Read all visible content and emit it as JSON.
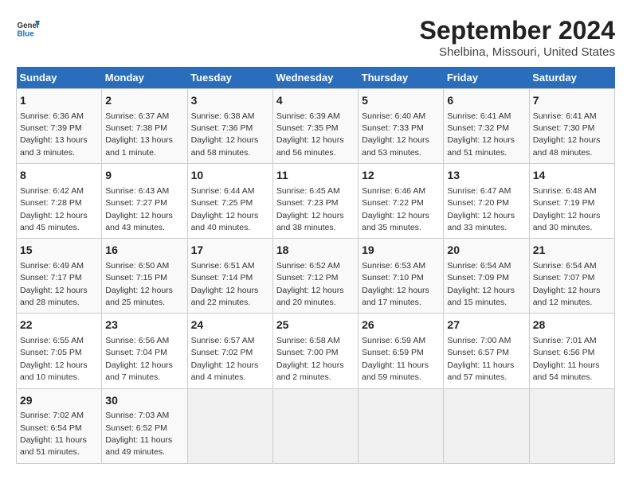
{
  "logo": {
    "line1": "General",
    "line2": "Blue"
  },
  "title": "September 2024",
  "subtitle": "Shelbina, Missouri, United States",
  "days_of_week": [
    "Sunday",
    "Monday",
    "Tuesday",
    "Wednesday",
    "Thursday",
    "Friday",
    "Saturday"
  ],
  "weeks": [
    [
      {
        "day": 1,
        "info": "Sunrise: 6:36 AM\nSunset: 7:39 PM\nDaylight: 13 hours\nand 3 minutes."
      },
      {
        "day": 2,
        "info": "Sunrise: 6:37 AM\nSunset: 7:38 PM\nDaylight: 13 hours\nand 1 minute."
      },
      {
        "day": 3,
        "info": "Sunrise: 6:38 AM\nSunset: 7:36 PM\nDaylight: 12 hours\nand 58 minutes."
      },
      {
        "day": 4,
        "info": "Sunrise: 6:39 AM\nSunset: 7:35 PM\nDaylight: 12 hours\nand 56 minutes."
      },
      {
        "day": 5,
        "info": "Sunrise: 6:40 AM\nSunset: 7:33 PM\nDaylight: 12 hours\nand 53 minutes."
      },
      {
        "day": 6,
        "info": "Sunrise: 6:41 AM\nSunset: 7:32 PM\nDaylight: 12 hours\nand 51 minutes."
      },
      {
        "day": 7,
        "info": "Sunrise: 6:41 AM\nSunset: 7:30 PM\nDaylight: 12 hours\nand 48 minutes."
      }
    ],
    [
      {
        "day": 8,
        "info": "Sunrise: 6:42 AM\nSunset: 7:28 PM\nDaylight: 12 hours\nand 45 minutes."
      },
      {
        "day": 9,
        "info": "Sunrise: 6:43 AM\nSunset: 7:27 PM\nDaylight: 12 hours\nand 43 minutes."
      },
      {
        "day": 10,
        "info": "Sunrise: 6:44 AM\nSunset: 7:25 PM\nDaylight: 12 hours\nand 40 minutes."
      },
      {
        "day": 11,
        "info": "Sunrise: 6:45 AM\nSunset: 7:23 PM\nDaylight: 12 hours\nand 38 minutes."
      },
      {
        "day": 12,
        "info": "Sunrise: 6:46 AM\nSunset: 7:22 PM\nDaylight: 12 hours\nand 35 minutes."
      },
      {
        "day": 13,
        "info": "Sunrise: 6:47 AM\nSunset: 7:20 PM\nDaylight: 12 hours\nand 33 minutes."
      },
      {
        "day": 14,
        "info": "Sunrise: 6:48 AM\nSunset: 7:19 PM\nDaylight: 12 hours\nand 30 minutes."
      }
    ],
    [
      {
        "day": 15,
        "info": "Sunrise: 6:49 AM\nSunset: 7:17 PM\nDaylight: 12 hours\nand 28 minutes."
      },
      {
        "day": 16,
        "info": "Sunrise: 6:50 AM\nSunset: 7:15 PM\nDaylight: 12 hours\nand 25 minutes."
      },
      {
        "day": 17,
        "info": "Sunrise: 6:51 AM\nSunset: 7:14 PM\nDaylight: 12 hours\nand 22 minutes."
      },
      {
        "day": 18,
        "info": "Sunrise: 6:52 AM\nSunset: 7:12 PM\nDaylight: 12 hours\nand 20 minutes."
      },
      {
        "day": 19,
        "info": "Sunrise: 6:53 AM\nSunset: 7:10 PM\nDaylight: 12 hours\nand 17 minutes."
      },
      {
        "day": 20,
        "info": "Sunrise: 6:54 AM\nSunset: 7:09 PM\nDaylight: 12 hours\nand 15 minutes."
      },
      {
        "day": 21,
        "info": "Sunrise: 6:54 AM\nSunset: 7:07 PM\nDaylight: 12 hours\nand 12 minutes."
      }
    ],
    [
      {
        "day": 22,
        "info": "Sunrise: 6:55 AM\nSunset: 7:05 PM\nDaylight: 12 hours\nand 10 minutes."
      },
      {
        "day": 23,
        "info": "Sunrise: 6:56 AM\nSunset: 7:04 PM\nDaylight: 12 hours\nand 7 minutes."
      },
      {
        "day": 24,
        "info": "Sunrise: 6:57 AM\nSunset: 7:02 PM\nDaylight: 12 hours\nand 4 minutes."
      },
      {
        "day": 25,
        "info": "Sunrise: 6:58 AM\nSunset: 7:00 PM\nDaylight: 12 hours\nand 2 minutes."
      },
      {
        "day": 26,
        "info": "Sunrise: 6:59 AM\nSunset: 6:59 PM\nDaylight: 11 hours\nand 59 minutes."
      },
      {
        "day": 27,
        "info": "Sunrise: 7:00 AM\nSunset: 6:57 PM\nDaylight: 11 hours\nand 57 minutes."
      },
      {
        "day": 28,
        "info": "Sunrise: 7:01 AM\nSunset: 6:56 PM\nDaylight: 11 hours\nand 54 minutes."
      }
    ],
    [
      {
        "day": 29,
        "info": "Sunrise: 7:02 AM\nSunset: 6:54 PM\nDaylight: 11 hours\nand 51 minutes."
      },
      {
        "day": 30,
        "info": "Sunrise: 7:03 AM\nSunset: 6:52 PM\nDaylight: 11 hours\nand 49 minutes."
      },
      null,
      null,
      null,
      null,
      null
    ]
  ]
}
